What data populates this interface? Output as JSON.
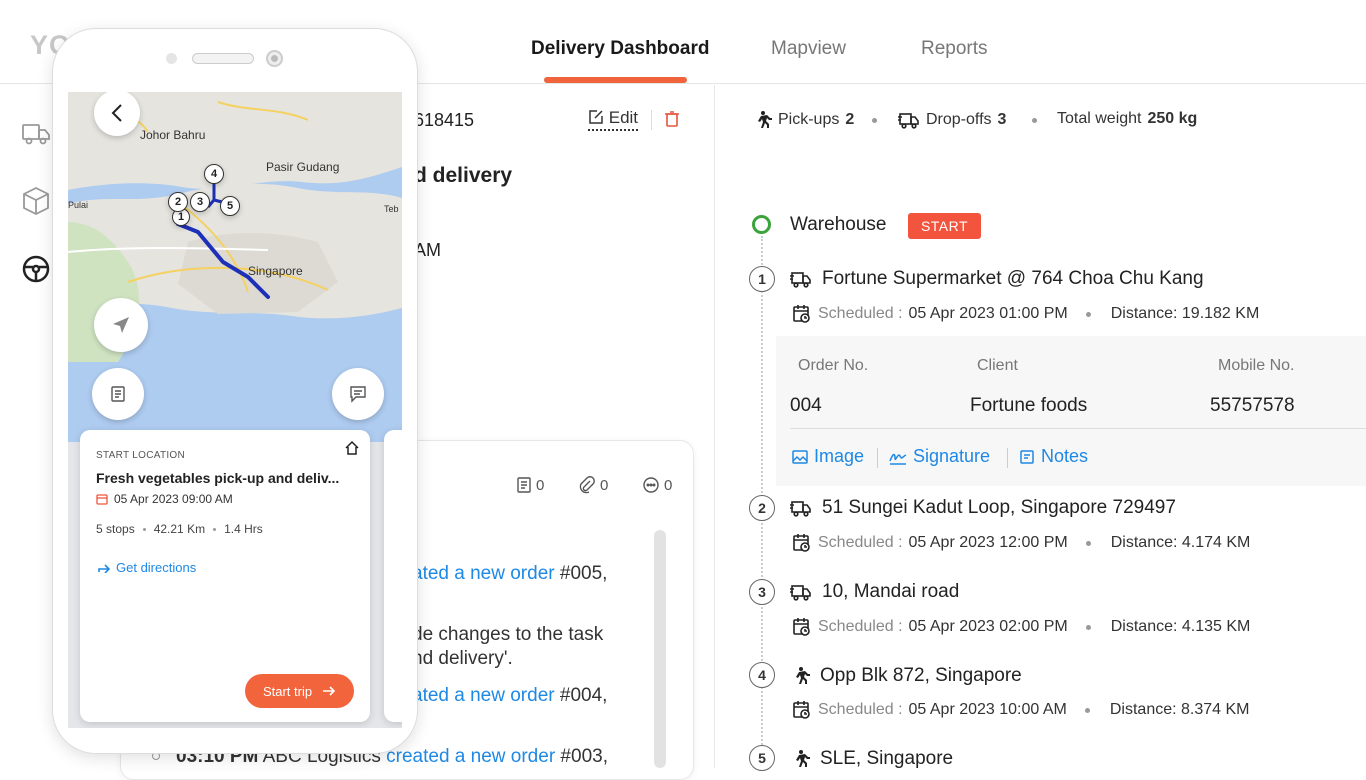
{
  "header": {
    "logo": "YO",
    "tabs": [
      {
        "label": "Delivery Dashboard"
      },
      {
        "label": "Mapview"
      },
      {
        "label": "Reports"
      }
    ]
  },
  "middle": {
    "order_id_fragment": "618415",
    "edit_label": "Edit",
    "task_title_fragment": "d delivery",
    "time_fragment": "AM",
    "counts": {
      "notes": "0",
      "attachments": "0",
      "comments": "0"
    },
    "activity": [
      {
        "prefix": "",
        "link": "ated a new order",
        "suffix": " #005,"
      },
      {
        "prefix": "de changes to the task",
        "link": "",
        "suffix": ""
      },
      {
        "prefix": "nd delivery'.",
        "link": "",
        "suffix": ""
      },
      {
        "prefix": "",
        "link": "ated a new order",
        "suffix": " #004,"
      },
      {
        "time": "03:10 PM",
        "prefix": "  ABC Logistics ",
        "link": "created a new order",
        "suffix": " #003,"
      }
    ]
  },
  "summary": {
    "pickups_label": "Pick-ups",
    "pickups_value": "2",
    "dropoffs_label": "Drop-offs",
    "dropoffs_value": "3",
    "weight_label": "Total weight",
    "weight_value": "250 kg"
  },
  "route": {
    "warehouse_label": "Warehouse",
    "start_badge": "START",
    "stops": [
      {
        "num": "1",
        "type": "drop",
        "title": "Fortune Supermarket @ 764 Choa Chu Kang",
        "sched_label": "Scheduled :",
        "sched": "05 Apr 2023 01:00 PM",
        "distance": "Distance: 19.182 KM"
      },
      {
        "num": "2",
        "type": "drop",
        "title": "51 Sungei Kadut Loop, Singapore 729497",
        "sched_label": "Scheduled :",
        "sched": "05 Apr 2023 12:00 PM",
        "distance": "Distance: 4.174 KM"
      },
      {
        "num": "3",
        "type": "drop",
        "title": "10, Mandai road",
        "sched_label": "Scheduled :",
        "sched": "05 Apr 2023 02:00 PM",
        "distance": "Distance: 4.135 KM"
      },
      {
        "num": "4",
        "type": "pickup",
        "title": "Opp Blk 872, Singapore",
        "sched_label": "Scheduled :",
        "sched": "05 Apr 2023 10:00 AM",
        "distance": "Distance: 8.374 KM"
      },
      {
        "num": "5",
        "type": "pickup",
        "title": "SLE, Singapore"
      }
    ],
    "order_table": {
      "headers": [
        "Order No.",
        "Client",
        "Mobile No."
      ],
      "row": [
        "004",
        "Fortune foods",
        "55757578"
      ]
    },
    "links": [
      "Image",
      "Signature",
      "Notes"
    ]
  },
  "phone": {
    "map_labels": [
      "Johor Bahru",
      "Pasir Gudang",
      "Singapore",
      "Pulai",
      "Teb"
    ],
    "markers": [
      "1",
      "2",
      "3",
      "4",
      "5"
    ],
    "card": {
      "small": "START LOCATION",
      "title": "Fresh vegetables pick-up and deliv...",
      "date": "05 Apr 2023 09:00 AM",
      "stops": "5 stops",
      "km": "42.21 Km",
      "hrs": "1.4 Hrs",
      "directions": "Get directions",
      "start_trip": "Start trip"
    }
  },
  "colors": {
    "accent": "#f0643c",
    "link": "#1e88e5",
    "start_green": "#3aa33a"
  }
}
